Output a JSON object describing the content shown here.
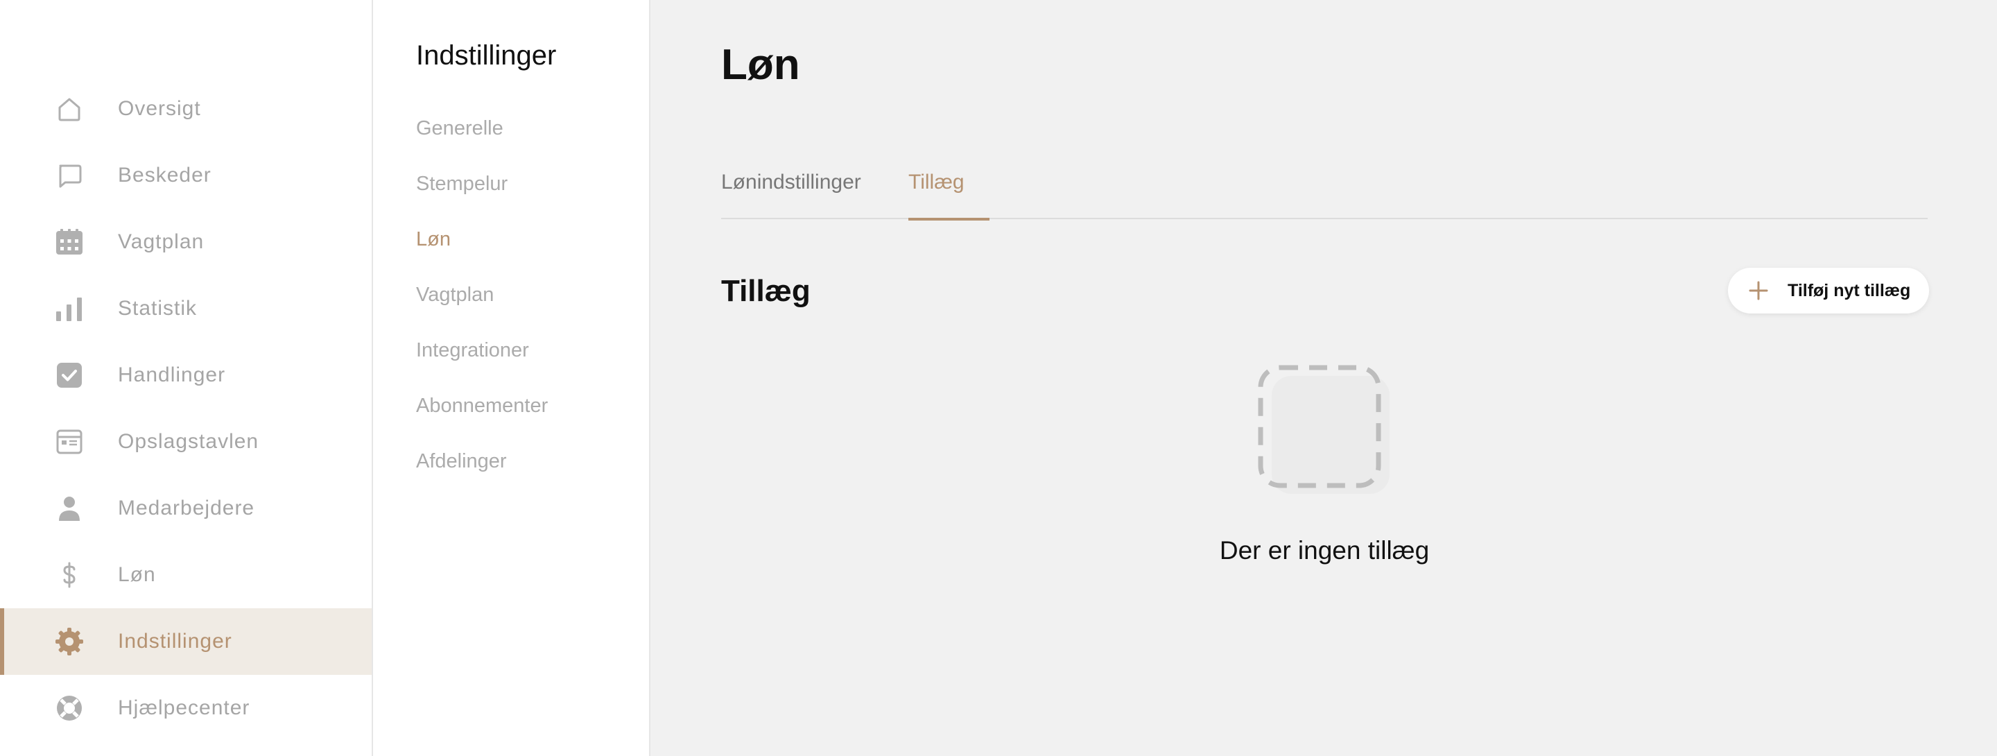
{
  "colors": {
    "accent": "#b59271",
    "active_bg": "#f0ebe4",
    "muted_text": "#a5a5a5",
    "background": "#f1f1f1"
  },
  "sidebar": {
    "items": [
      {
        "label": "Oversigt",
        "icon": "home-icon"
      },
      {
        "label": "Beskeder",
        "icon": "message-icon"
      },
      {
        "label": "Vagtplan",
        "icon": "calendar-icon"
      },
      {
        "label": "Statistik",
        "icon": "bar-chart-icon"
      },
      {
        "label": "Handlinger",
        "icon": "checkbox-icon"
      },
      {
        "label": "Opslagstavlen",
        "icon": "board-icon"
      },
      {
        "label": "Medarbejdere",
        "icon": "person-icon"
      },
      {
        "label": "Løn",
        "icon": "dollar-icon"
      },
      {
        "label": "Indstillinger",
        "icon": "gear-icon",
        "active": true
      },
      {
        "label": "Hjælpecenter",
        "icon": "lifebuoy-icon"
      }
    ]
  },
  "settings_nav": {
    "title": "Indstillinger",
    "items": [
      {
        "label": "Generelle"
      },
      {
        "label": "Stempelur"
      },
      {
        "label": "Løn",
        "active": true
      },
      {
        "label": "Vagtplan"
      },
      {
        "label": "Integrationer"
      },
      {
        "label": "Abonnementer"
      },
      {
        "label": "Afdelinger"
      }
    ]
  },
  "main": {
    "title": "Løn",
    "tabs": [
      {
        "label": "Lønindstillinger"
      },
      {
        "label": "Tillæg",
        "active": true
      }
    ],
    "section_title": "Tillæg",
    "add_button_label": "Tilføj nyt tillæg",
    "empty_state_text": "Der er ingen tillæg"
  }
}
